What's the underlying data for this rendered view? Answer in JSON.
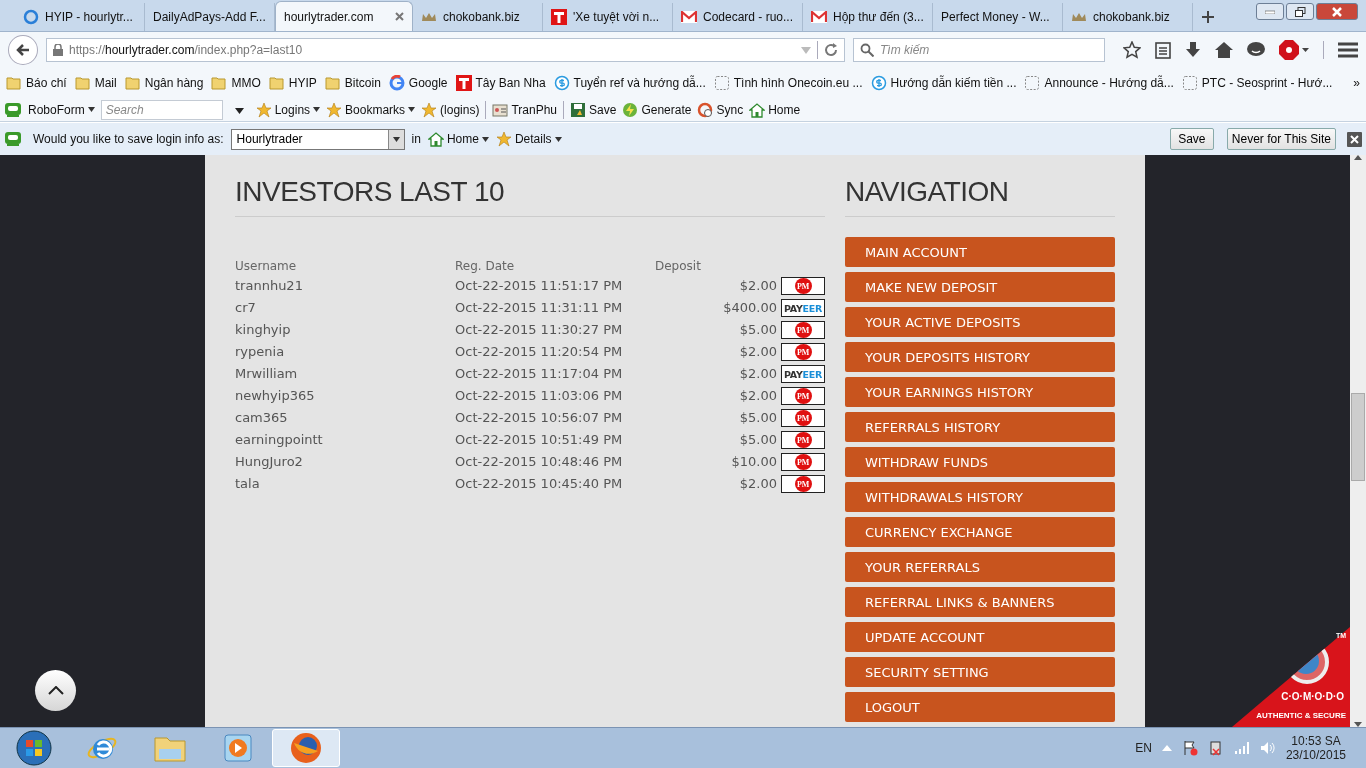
{
  "tabs": [
    {
      "label": "HYIP - hourlytr...",
      "kind": "loading",
      "selected": false
    },
    {
      "label": "DailyAdPays-Add F...",
      "selected": false
    },
    {
      "label": "hourlytrader.com",
      "selected": true
    },
    {
      "label": "chokobank.biz",
      "kind": "crown",
      "selected": false
    },
    {
      "label": "'Xe tuyệt vời n...",
      "kind": "tbrand",
      "selected": false
    },
    {
      "label": "Codecard - ruo...",
      "kind": "mail",
      "selected": false
    },
    {
      "label": "Hộp thư đến (3...",
      "kind": "mail",
      "selected": false
    },
    {
      "label": "Perfect Money - W...",
      "selected": false
    },
    {
      "label": "chokobank.biz",
      "kind": "crown",
      "selected": false
    }
  ],
  "url": {
    "scheme": "https://",
    "host": "hourlytrader.com",
    "path": "/index.php?a=last10"
  },
  "search": {
    "placeholder": "Tìm kiếm"
  },
  "bookmarks": [
    {
      "label": "Báo chí",
      "kind": "folder"
    },
    {
      "label": "Mail",
      "kind": "folder"
    },
    {
      "label": "Ngân hàng",
      "kind": "folder"
    },
    {
      "label": "MMO",
      "kind": "folder"
    },
    {
      "label": "HYIP",
      "kind": "folder"
    },
    {
      "label": "Bitcoin",
      "kind": "folder"
    },
    {
      "label": "Google",
      "kind": "google"
    },
    {
      "label": "Tây Ban Nha",
      "kind": "tbrand"
    },
    {
      "label": "Tuyển ref và hướng dẫ...",
      "kind": "dollar"
    },
    {
      "label": "Tình hình Onecoin.eu ...",
      "kind": "blank"
    },
    {
      "label": "Hướng dẫn kiếm tiền ...",
      "kind": "dollar"
    },
    {
      "label": "Announce - Hướng dẫ...",
      "kind": "blank"
    },
    {
      "label": "PTC - Seosprint - Hướ...",
      "kind": "blank"
    }
  ],
  "bookmarks_more": "»",
  "roboform": {
    "label": "RoboForm",
    "search_placeholder": "Search",
    "items": [
      {
        "label": "Logins",
        "kind": "star",
        "dropdown": true
      },
      {
        "label": "Bookmarks",
        "kind": "star",
        "dropdown": true
      },
      {
        "label": "(logins)",
        "kind": "star",
        "dropdown": false
      },
      {
        "label": "TranPhu",
        "kind": "card",
        "dropdown": false
      },
      {
        "label": "Save",
        "kind": "disk",
        "dropdown": false
      },
      {
        "label": "Generate",
        "kind": "bolt",
        "dropdown": false
      },
      {
        "label": "Sync",
        "kind": "sync",
        "dropdown": false
      },
      {
        "label": "Home",
        "kind": "house",
        "dropdown": false
      }
    ]
  },
  "save_prompt": {
    "question": "Would you like to save login info as:",
    "value": "Hourlytrader",
    "in": "in",
    "folder": "Home",
    "details": "Details",
    "save": "Save",
    "never": "Never for This Site"
  },
  "page": {
    "heading": "INVESTORS LAST 10",
    "columns": [
      "Username",
      "Reg. Date",
      "Deposit"
    ],
    "rows": [
      {
        "username": "trannhu21",
        "date": "Oct-22-2015 11:51:17 PM",
        "amount": "$2.00",
        "method": {
          "kind": "pm",
          "label": "PM"
        }
      },
      {
        "username": "cr7",
        "date": "Oct-22-2015 11:31:11 PM",
        "amount": "$400.00",
        "method": {
          "kind": "payeer",
          "label": "PAYEER"
        }
      },
      {
        "username": "kinghyip",
        "date": "Oct-22-2015 11:30:27 PM",
        "amount": "$5.00",
        "method": {
          "kind": "pm",
          "label": "PM"
        }
      },
      {
        "username": "rypenia",
        "date": "Oct-22-2015 11:20:54 PM",
        "amount": "$2.00",
        "method": {
          "kind": "pm",
          "label": "PM"
        }
      },
      {
        "username": "Mrwilliam",
        "date": "Oct-22-2015 11:17:04 PM",
        "amount": "$2.00",
        "method": {
          "kind": "payeer",
          "label": "PAYEER"
        }
      },
      {
        "username": "newhyip365",
        "date": "Oct-22-2015 11:03:06 PM",
        "amount": "$2.00",
        "method": {
          "kind": "pm",
          "label": "PM"
        }
      },
      {
        "username": "cam365",
        "date": "Oct-22-2015 10:56:07 PM",
        "amount": "$5.00",
        "method": {
          "kind": "pm",
          "label": "PM"
        }
      },
      {
        "username": "earningpointt",
        "date": "Oct-22-2015 10:51:49 PM",
        "amount": "$5.00",
        "method": {
          "kind": "pm",
          "label": "PM"
        }
      },
      {
        "username": "HungJuro2",
        "date": "Oct-22-2015 10:48:46 PM",
        "amount": "$10.00",
        "method": {
          "kind": "pm",
          "label": "PM"
        }
      },
      {
        "username": "tala",
        "date": "Oct-22-2015 10:45:40 PM",
        "amount": "$2.00",
        "method": {
          "kind": "pm",
          "label": "PM"
        }
      }
    ],
    "nav_heading": "NAVIGATION",
    "nav": [
      "MAIN ACCOUNT",
      "MAKE NEW DEPOSIT",
      "YOUR ACTIVE DEPOSITS",
      "YOUR DEPOSITS HISTORY",
      "YOUR EARNINGS HISTORY",
      "REFERRALS HISTORY",
      "WITHDRAW FUNDS",
      "WITHDRAWALS HISTORY",
      "CURRENCY EXCHANGE",
      "YOUR REFERRALS",
      "REFERRAL LINKS & BANNERS",
      "UPDATE ACCOUNT",
      "SECURITY SETTING",
      "LOGOUT"
    ]
  },
  "comodo": {
    "brand": "C·O·M·O·D·O",
    "tagline": "AUTHENTIC & SECURE",
    "tm": "TM"
  },
  "taskbar": {
    "apps": [
      {
        "kind": "ie",
        "selected": false
      },
      {
        "kind": "folder",
        "selected": false
      },
      {
        "kind": "media",
        "selected": false
      },
      {
        "kind": "firefox",
        "selected": true
      }
    ],
    "lang": "EN",
    "time": "10:53 SA",
    "date": "23/10/2015"
  }
}
